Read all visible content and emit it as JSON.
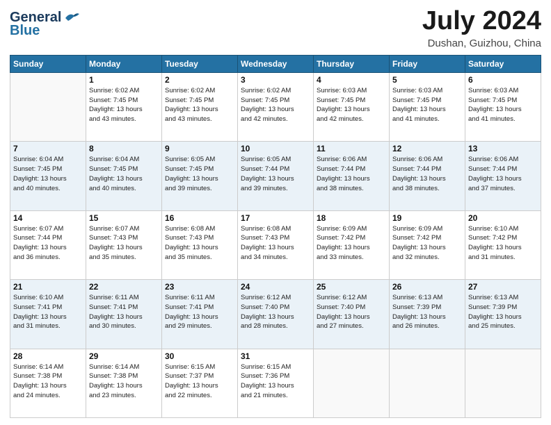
{
  "header": {
    "logo_line1": "General",
    "logo_line2": "Blue",
    "month": "July 2024",
    "location": "Dushan, Guizhou, China"
  },
  "weekdays": [
    "Sunday",
    "Monday",
    "Tuesday",
    "Wednesday",
    "Thursday",
    "Friday",
    "Saturday"
  ],
  "weeks": [
    [
      {
        "day": "",
        "sunrise": "",
        "sunset": "",
        "daylight": ""
      },
      {
        "day": "1",
        "sunrise": "Sunrise: 6:02 AM",
        "sunset": "Sunset: 7:45 PM",
        "daylight": "Daylight: 13 hours and 43 minutes."
      },
      {
        "day": "2",
        "sunrise": "Sunrise: 6:02 AM",
        "sunset": "Sunset: 7:45 PM",
        "daylight": "Daylight: 13 hours and 43 minutes."
      },
      {
        "day": "3",
        "sunrise": "Sunrise: 6:02 AM",
        "sunset": "Sunset: 7:45 PM",
        "daylight": "Daylight: 13 hours and 42 minutes."
      },
      {
        "day": "4",
        "sunrise": "Sunrise: 6:03 AM",
        "sunset": "Sunset: 7:45 PM",
        "daylight": "Daylight: 13 hours and 42 minutes."
      },
      {
        "day": "5",
        "sunrise": "Sunrise: 6:03 AM",
        "sunset": "Sunset: 7:45 PM",
        "daylight": "Daylight: 13 hours and 41 minutes."
      },
      {
        "day": "6",
        "sunrise": "Sunrise: 6:03 AM",
        "sunset": "Sunset: 7:45 PM",
        "daylight": "Daylight: 13 hours and 41 minutes."
      }
    ],
    [
      {
        "day": "7",
        "sunrise": "Sunrise: 6:04 AM",
        "sunset": "Sunset: 7:45 PM",
        "daylight": "Daylight: 13 hours and 40 minutes."
      },
      {
        "day": "8",
        "sunrise": "Sunrise: 6:04 AM",
        "sunset": "Sunset: 7:45 PM",
        "daylight": "Daylight: 13 hours and 40 minutes."
      },
      {
        "day": "9",
        "sunrise": "Sunrise: 6:05 AM",
        "sunset": "Sunset: 7:45 PM",
        "daylight": "Daylight: 13 hours and 39 minutes."
      },
      {
        "day": "10",
        "sunrise": "Sunrise: 6:05 AM",
        "sunset": "Sunset: 7:44 PM",
        "daylight": "Daylight: 13 hours and 39 minutes."
      },
      {
        "day": "11",
        "sunrise": "Sunrise: 6:06 AM",
        "sunset": "Sunset: 7:44 PM",
        "daylight": "Daylight: 13 hours and 38 minutes."
      },
      {
        "day": "12",
        "sunrise": "Sunrise: 6:06 AM",
        "sunset": "Sunset: 7:44 PM",
        "daylight": "Daylight: 13 hours and 38 minutes."
      },
      {
        "day": "13",
        "sunrise": "Sunrise: 6:06 AM",
        "sunset": "Sunset: 7:44 PM",
        "daylight": "Daylight: 13 hours and 37 minutes."
      }
    ],
    [
      {
        "day": "14",
        "sunrise": "Sunrise: 6:07 AM",
        "sunset": "Sunset: 7:44 PM",
        "daylight": "Daylight: 13 hours and 36 minutes."
      },
      {
        "day": "15",
        "sunrise": "Sunrise: 6:07 AM",
        "sunset": "Sunset: 7:43 PM",
        "daylight": "Daylight: 13 hours and 35 minutes."
      },
      {
        "day": "16",
        "sunrise": "Sunrise: 6:08 AM",
        "sunset": "Sunset: 7:43 PM",
        "daylight": "Daylight: 13 hours and 35 minutes."
      },
      {
        "day": "17",
        "sunrise": "Sunrise: 6:08 AM",
        "sunset": "Sunset: 7:43 PM",
        "daylight": "Daylight: 13 hours and 34 minutes."
      },
      {
        "day": "18",
        "sunrise": "Sunrise: 6:09 AM",
        "sunset": "Sunset: 7:42 PM",
        "daylight": "Daylight: 13 hours and 33 minutes."
      },
      {
        "day": "19",
        "sunrise": "Sunrise: 6:09 AM",
        "sunset": "Sunset: 7:42 PM",
        "daylight": "Daylight: 13 hours and 32 minutes."
      },
      {
        "day": "20",
        "sunrise": "Sunrise: 6:10 AM",
        "sunset": "Sunset: 7:42 PM",
        "daylight": "Daylight: 13 hours and 31 minutes."
      }
    ],
    [
      {
        "day": "21",
        "sunrise": "Sunrise: 6:10 AM",
        "sunset": "Sunset: 7:41 PM",
        "daylight": "Daylight: 13 hours and 31 minutes."
      },
      {
        "day": "22",
        "sunrise": "Sunrise: 6:11 AM",
        "sunset": "Sunset: 7:41 PM",
        "daylight": "Daylight: 13 hours and 30 minutes."
      },
      {
        "day": "23",
        "sunrise": "Sunrise: 6:11 AM",
        "sunset": "Sunset: 7:41 PM",
        "daylight": "Daylight: 13 hours and 29 minutes."
      },
      {
        "day": "24",
        "sunrise": "Sunrise: 6:12 AM",
        "sunset": "Sunset: 7:40 PM",
        "daylight": "Daylight: 13 hours and 28 minutes."
      },
      {
        "day": "25",
        "sunrise": "Sunrise: 6:12 AM",
        "sunset": "Sunset: 7:40 PM",
        "daylight": "Daylight: 13 hours and 27 minutes."
      },
      {
        "day": "26",
        "sunrise": "Sunrise: 6:13 AM",
        "sunset": "Sunset: 7:39 PM",
        "daylight": "Daylight: 13 hours and 26 minutes."
      },
      {
        "day": "27",
        "sunrise": "Sunrise: 6:13 AM",
        "sunset": "Sunset: 7:39 PM",
        "daylight": "Daylight: 13 hours and 25 minutes."
      }
    ],
    [
      {
        "day": "28",
        "sunrise": "Sunrise: 6:14 AM",
        "sunset": "Sunset: 7:38 PM",
        "daylight": "Daylight: 13 hours and 24 minutes."
      },
      {
        "day": "29",
        "sunrise": "Sunrise: 6:14 AM",
        "sunset": "Sunset: 7:38 PM",
        "daylight": "Daylight: 13 hours and 23 minutes."
      },
      {
        "day": "30",
        "sunrise": "Sunrise: 6:15 AM",
        "sunset": "Sunset: 7:37 PM",
        "daylight": "Daylight: 13 hours and 22 minutes."
      },
      {
        "day": "31",
        "sunrise": "Sunrise: 6:15 AM",
        "sunset": "Sunset: 7:36 PM",
        "daylight": "Daylight: 13 hours and 21 minutes."
      },
      {
        "day": "",
        "sunrise": "",
        "sunset": "",
        "daylight": ""
      },
      {
        "day": "",
        "sunrise": "",
        "sunset": "",
        "daylight": ""
      },
      {
        "day": "",
        "sunrise": "",
        "sunset": "",
        "daylight": ""
      }
    ]
  ]
}
